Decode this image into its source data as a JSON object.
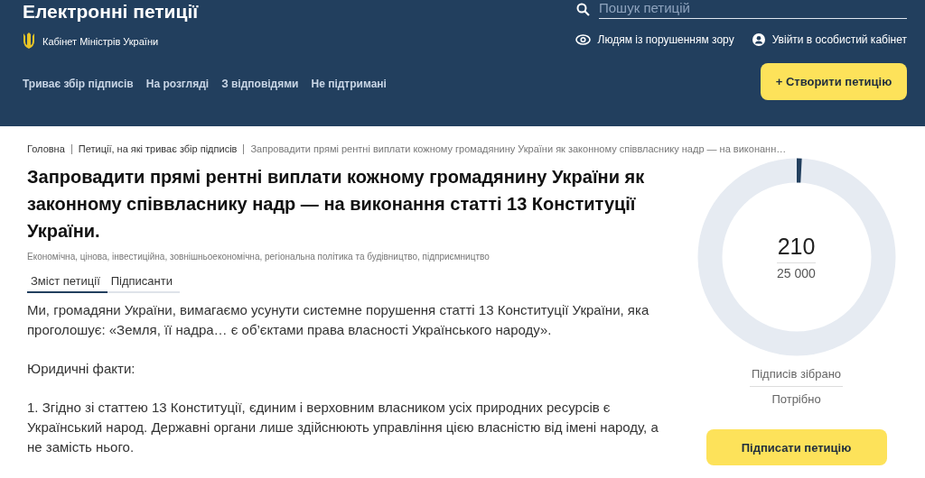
{
  "header": {
    "title": "Електронні петиції",
    "org": "Кабінет Міністрів України",
    "search": {
      "placeholder": "Пошук петицій"
    },
    "links": [
      {
        "kind": "eye",
        "label": "Людям із порушенням зору"
      },
      {
        "kind": "user",
        "label": "Увійти в особистий кабінет"
      }
    ],
    "nav": [
      "Триває збір підписів",
      "На розгляді",
      "З відповідями",
      "Не підтримані"
    ],
    "create_button": "+ Створити петицію"
  },
  "breadcrumbs": [
    "Головна",
    "Петиції, на які триває збір підписів",
    "Запровадити прямі рентні виплати кожному громадянину України як законному співвласнику надр — на виконанн…"
  ],
  "petition": {
    "title": "Запровадити прямі рентні виплати кожному громадянину України як законному співвласнику надр — на виконання статті 13 Конституції України.",
    "tags": "Економічна, цінова, інвестиційна, зовнішньоекономічна, регіональна політика та будівництво, підприємництво",
    "tabs": [
      {
        "label": "Зміст петиції",
        "selected": true
      },
      {
        "label": "Підписанти",
        "selected": false
      }
    ],
    "paragraphs": [
      "Ми, громадяни України, вимагаємо усунути системне порушення статті 13 Конституції України, яка проголошує: «Земля, її надра… є об’єктами права власності Українського народу».",
      "Юридичні факти:",
      "1. Згідно зі статтею 13 Конституції, єдиним і верховним власником усіх природних ресурсів є Український народ. Державні органи лише здійснюють управління цією власністю від імені народу, а не замість нього."
    ]
  },
  "signatures": {
    "collected": "210",
    "needed": "25 000",
    "level": 0.0084,
    "collected_label": "Підписів зібрано",
    "needed_label": "Потрібно",
    "sign_button": "Підписати петицію"
  }
}
